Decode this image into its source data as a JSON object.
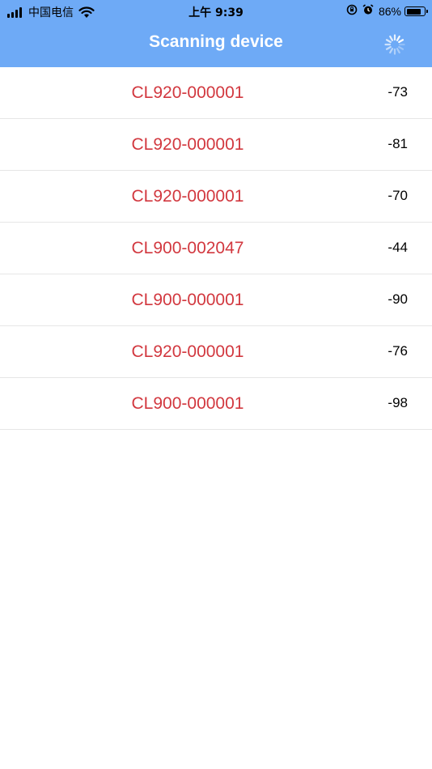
{
  "status_bar": {
    "carrier": "中国电信",
    "time": "上午 9:39",
    "battery_percent": "86%",
    "battery_level": 0.86,
    "icons": [
      "signal-icon",
      "wifi-icon",
      "orientation-lock-icon",
      "alarm-icon",
      "battery-icon"
    ]
  },
  "header": {
    "title": "Scanning device",
    "spinner_icon": "loading-spinner-icon",
    "background_color": "#6eaaf6"
  },
  "devices": [
    {
      "name": "CL920-000001",
      "rssi": "-73"
    },
    {
      "name": "CL920-000001",
      "rssi": "-81"
    },
    {
      "name": "CL920-000001",
      "rssi": "-70"
    },
    {
      "name": "CL900-002047",
      "rssi": "-44"
    },
    {
      "name": "CL900-000001",
      "rssi": "-90"
    },
    {
      "name": "CL920-000001",
      "rssi": "-76"
    },
    {
      "name": "CL900-000001",
      "rssi": "-98"
    }
  ],
  "colors": {
    "device_name": "#d2383f",
    "rssi": "#000000",
    "divider": "#e6e6e6"
  }
}
